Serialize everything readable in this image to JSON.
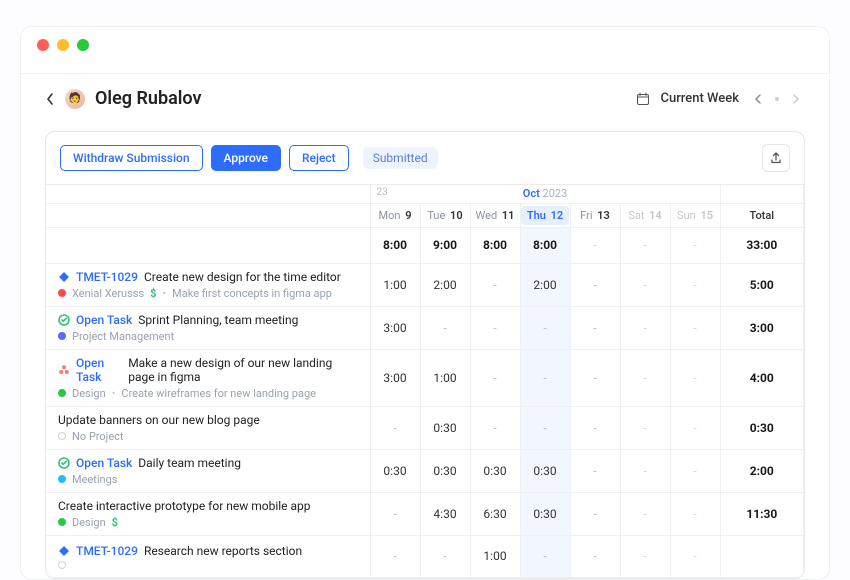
{
  "user": {
    "name": "Oleg Rubalov"
  },
  "period": {
    "label": "Current Week",
    "prev_day": "23",
    "month": "Oct",
    "year": "2023"
  },
  "toolbar": {
    "withdraw": "Withdraw Submission",
    "approve": "Approve",
    "reject": "Reject",
    "status": "Submitted"
  },
  "days": [
    {
      "dow": "Mon",
      "num": "9",
      "current": false,
      "weekend": false
    },
    {
      "dow": "Tue",
      "num": "10",
      "current": false,
      "weekend": false
    },
    {
      "dow": "Wed",
      "num": "11",
      "current": false,
      "weekend": false
    },
    {
      "dow": "Thu",
      "num": "12",
      "current": true,
      "weekend": false
    },
    {
      "dow": "Fri",
      "num": "13",
      "current": false,
      "weekend": false
    },
    {
      "dow": "Sat",
      "num": "14",
      "current": false,
      "weekend": true
    },
    {
      "dow": "Sun",
      "num": "15",
      "current": false,
      "weekend": true
    }
  ],
  "total_label": "Total",
  "day_totals": [
    "8:00",
    "9:00",
    "8:00",
    "8:00",
    "-",
    "-",
    "-"
  ],
  "grand_total": "33:00",
  "rows": [
    {
      "icon": "diamond",
      "icon_color": "#2e6cff",
      "ticket": "TMET-1029",
      "title": "Create new design for the time editor",
      "project_color": "#ff4d4d",
      "project": "Xenial Xerusss",
      "billable": true,
      "note": "Make first concepts in figma app",
      "times": [
        "1:00",
        "2:00",
        "-",
        "2:00",
        "-",
        "-",
        "-"
      ],
      "total": "5:00"
    },
    {
      "icon": "circle-check",
      "icon_color": "#33c07a",
      "ticket": "Open Task",
      "title": "Sprint Planning, team meeting",
      "project_color": "#5a6bff",
      "project": "Project Management",
      "billable": false,
      "note": "",
      "times": [
        "3:00",
        "-",
        "-",
        "-",
        "-",
        "-",
        "-"
      ],
      "total": "3:00"
    },
    {
      "icon": "asana",
      "icon_color": "#ff7a6b",
      "ticket": "Open Task",
      "title": "Make a new design of our new landing page in figma",
      "project_color": "#28c840",
      "project": "Design",
      "billable": false,
      "note": "Create wireframes for new landing page",
      "times": [
        "3:00",
        "1:00",
        "-",
        "-",
        "-",
        "-",
        "-"
      ],
      "total": "4:00"
    },
    {
      "icon": "",
      "icon_color": "",
      "ticket": "",
      "title": "Update banners on our new blog page",
      "project_color": "",
      "project": "No Project",
      "billable": false,
      "note": "",
      "times": [
        "-",
        "0:30",
        "-",
        "-",
        "-",
        "-",
        "-"
      ],
      "total": "0:30"
    },
    {
      "icon": "circle-check",
      "icon_color": "#33c07a",
      "ticket": "Open Task",
      "title": "Daily team meeting",
      "project_color": "#29b9ff",
      "project": "Meetings",
      "billable": false,
      "note": "",
      "times": [
        "0:30",
        "0:30",
        "0:30",
        "0:30",
        "-",
        "-",
        "-"
      ],
      "total": "2:00"
    },
    {
      "icon": "",
      "icon_color": "",
      "ticket": "",
      "title": "Create interactive prototype for new mobile app",
      "project_color": "#28c840",
      "project": "Design",
      "billable": true,
      "note": "",
      "times": [
        "-",
        "4:30",
        "6:30",
        "0:30",
        "-",
        "-",
        "-"
      ],
      "total": "11:30"
    },
    {
      "icon": "diamond",
      "icon_color": "#2e6cff",
      "ticket": "TMET-1029",
      "title": "Research new reports section",
      "project_color": "",
      "project": "",
      "billable": false,
      "note": "",
      "times": [
        "-",
        "-",
        "1:00",
        "-",
        "-",
        "-",
        "-"
      ],
      "total": ""
    }
  ]
}
